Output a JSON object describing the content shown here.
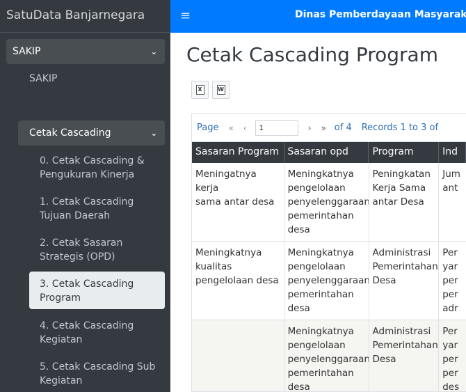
{
  "sidebar": {
    "brand": "SatuData Banjarnegara",
    "menu_sakip": "SAKIP",
    "sub_sakip": "SAKIP",
    "menu_cetak": "Cetak Cascading",
    "items": [
      "0. Cetak Cascading &\nPengukuran Kinerja",
      "1. Cetak Cascading\nTujuan Daerah",
      "2. Cetak Sasaran\nStrategis (OPD)",
      "3. Cetak Cascading\nProgram",
      "4. Cetak Cascading\nKegiatan",
      "5. Cetak Cascading Sub\nKegiatan"
    ],
    "active_index": 3
  },
  "topbar": {
    "menu_icon": "hamburger-icon",
    "title": "Dinas Pemberdayaan Masyarakat"
  },
  "main": {
    "title": "Cetak Cascading Program",
    "export": {
      "excel": "X",
      "word": "W"
    }
  },
  "pager": {
    "label": "Page",
    "first": "«",
    "prev": "‹",
    "page": "1",
    "next": "›",
    "last": "»",
    "of": "of 4",
    "records": "Records 1 to 3 of"
  },
  "table": {
    "headers": [
      "Sasaran Program",
      "Sasaran opd",
      "Program",
      "Ind"
    ],
    "rows": [
      [
        "Meningatnya kerja\nsama antar desa",
        "Meningkatnya\npengelolaan\npenyelenggaraan\npemerintahan\ndesa",
        "Peningkatan\nKerja Sama\nantar Desa",
        "Jum\nant"
      ],
      [
        "Meningkatnya\nkualitas\npengelolaan desa",
        "Meningkatnya\npengelolaan\npenyelenggaraan\npemerintahan\ndesa",
        "Administrasi\nPemerintahan\nDesa",
        "Per\nyar\nper\nper\nadr"
      ],
      [
        "",
        "Meningkatnya\npengelolaan\npenyelenggaraan\npemerintahan\ndesa",
        "Administrasi\nPemerintahan\nDesa",
        "Per\nyar\nper\nper\ndes"
      ]
    ]
  }
}
